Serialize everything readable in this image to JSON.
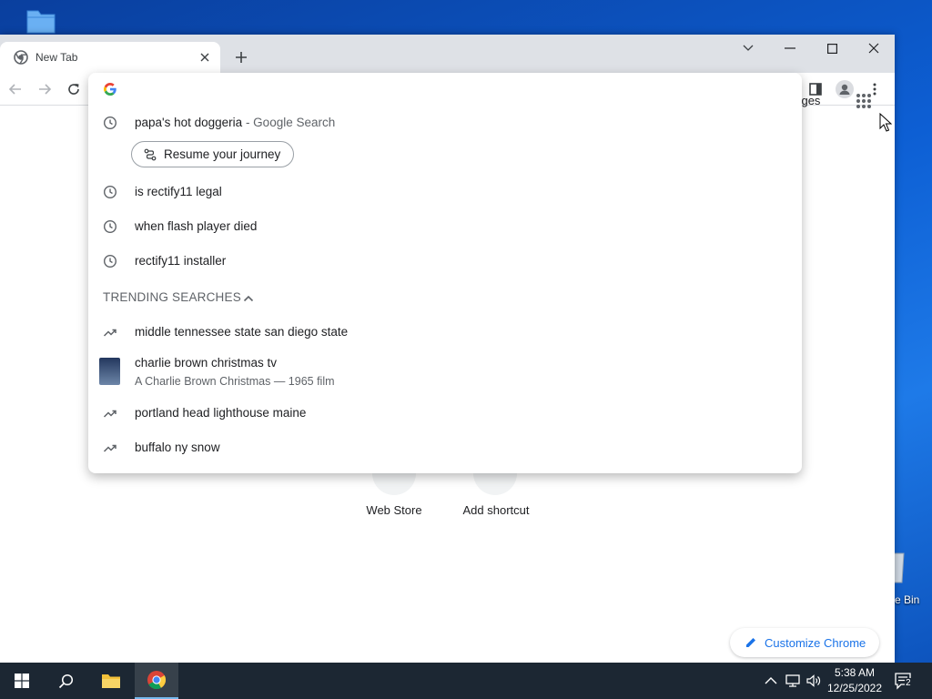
{
  "browser": {
    "tab": {
      "title": "New Tab"
    },
    "omnibox": {
      "value": ""
    }
  },
  "omnibox_dropdown": {
    "history": [
      {
        "query": "papa's hot doggeria",
        "suffix": "- Google Search"
      },
      {
        "query": "is rectify11 legal"
      },
      {
        "query": "when flash player died"
      },
      {
        "query": "rectify11 installer"
      }
    ],
    "journey_chip": "Resume your journey",
    "trending_header": "TRENDING SEARCHES",
    "trending": [
      {
        "query": "middle tennessee state san diego state"
      },
      {
        "query": "charlie brown christmas tv",
        "subtitle": "A Charlie Brown Christmas — 1965 film"
      },
      {
        "query": "portland head lighthouse maine"
      },
      {
        "query": "buffalo ny snow"
      }
    ]
  },
  "new_tab_page": {
    "images_link": "nages",
    "shortcuts": [
      "Web Store",
      "Add shortcut"
    ],
    "customize_label": "Customize Chrome"
  },
  "desktop": {
    "recycle_bin_label": "e Bin"
  },
  "taskbar": {
    "time": "5:38 AM",
    "date": "12/25/2022",
    "notification_count": "2"
  },
  "colors": {
    "accent_blue": "#1a73e8",
    "taskbar": "#1c2733"
  }
}
